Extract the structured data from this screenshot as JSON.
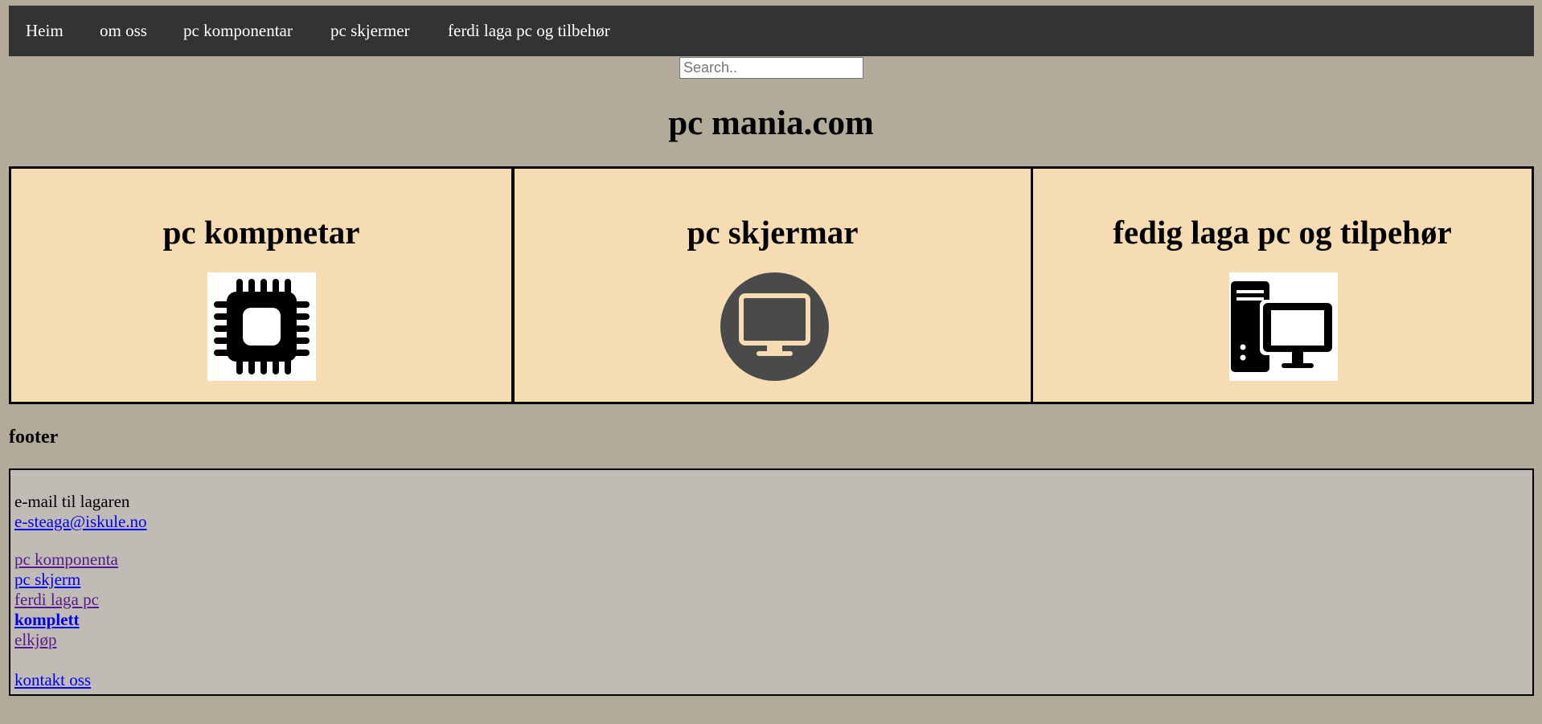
{
  "nav": {
    "items": [
      {
        "label": "Heim"
      },
      {
        "label": "om oss"
      },
      {
        "label": "pc komponentar"
      },
      {
        "label": "pc skjermer"
      },
      {
        "label": "ferdi laga pc og tilbehør"
      }
    ]
  },
  "search": {
    "placeholder": "Search.."
  },
  "site_title": "pc mania.com",
  "cards": [
    {
      "title": "pc kompnetar",
      "icon": "cpu-chip-icon"
    },
    {
      "title": "pc skjermar",
      "icon": "monitor-icon"
    },
    {
      "title": "fedig laga pc og tilpehør",
      "icon": "desktop-computer-icon"
    }
  ],
  "footer": {
    "heading": "footer",
    "email_label": "e-mail til lagaren",
    "email_link": "e-steaga@iskule.no",
    "links": [
      {
        "label": "pc komponenta"
      },
      {
        "label": "pc skjerm"
      },
      {
        "label": "ferdi laga pc"
      },
      {
        "label": "komplett"
      },
      {
        "label": "elkjøp"
      }
    ],
    "contact_link": "kontakt oss"
  },
  "colors": {
    "page_background": "#b3ab9a",
    "nav_background": "#333333",
    "card_background": "#f5dcb2",
    "footer_background": "#c0bbb5",
    "link": "#0000ee",
    "visited_link": "#551a8b"
  }
}
